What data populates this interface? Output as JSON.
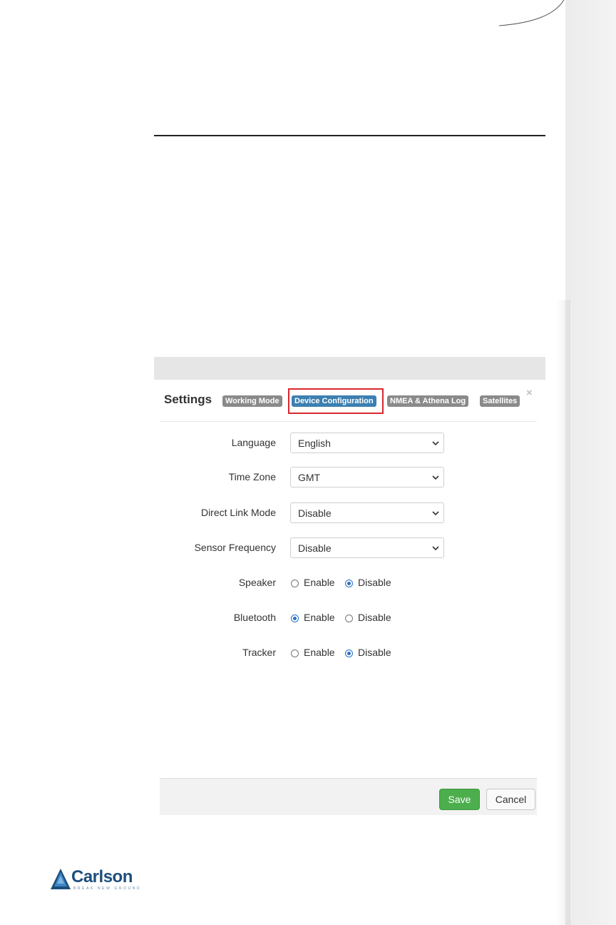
{
  "settings": {
    "title": "Settings",
    "tabs": [
      {
        "label": "Working Mode",
        "active": false
      },
      {
        "label": "Device Configuration",
        "active": true
      },
      {
        "label": "NMEA & Athena Log",
        "active": false
      },
      {
        "label": "Satellites",
        "active": false
      }
    ],
    "close_icon": "×",
    "fields": {
      "language": {
        "label": "Language",
        "value": "English"
      },
      "time_zone": {
        "label": "Time Zone",
        "value": "GMT"
      },
      "direct_link_mode": {
        "label": "Direct Link Mode",
        "value": "Disable"
      },
      "sensor_frequency": {
        "label": "Sensor Frequency",
        "value": "Disable"
      }
    },
    "radios": {
      "speaker": {
        "label": "Speaker",
        "enable": "Enable",
        "disable": "Disable",
        "selected": "Disable"
      },
      "bluetooth": {
        "label": "Bluetooth",
        "enable": "Enable",
        "disable": "Disable",
        "selected": "Enable"
      },
      "tracker": {
        "label": "Tracker",
        "enable": "Enable",
        "disable": "Disable",
        "selected": "Disable"
      }
    },
    "buttons": {
      "save": "Save",
      "cancel": "Cancel"
    }
  },
  "logo": {
    "name": "Carlson",
    "tagline": "BREAK NEW GROUND"
  },
  "colors": {
    "active_tab": "#3c7fb1",
    "inactive_tab": "#8a8a8a",
    "highlight": "#d9272e",
    "save": "#4cae4c",
    "brand": "#1c4e7c"
  }
}
